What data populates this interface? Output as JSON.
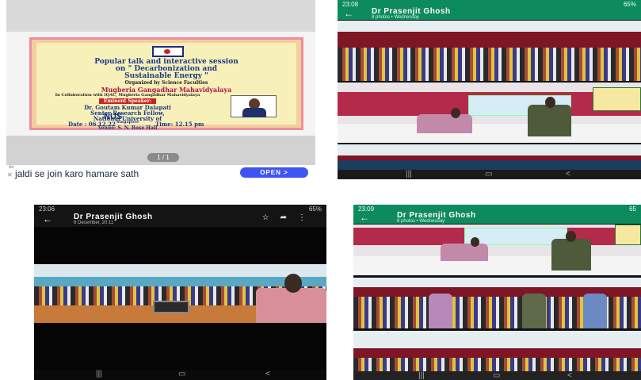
{
  "poster_viewer": {
    "poster": {
      "title_line1": "Popular talk and interactive session",
      "title_line2": "on \" Decarbonization and",
      "title_line3": "Sustainable Energy \"",
      "organized_by": "Organized by Science Faculties",
      "college": "Mugberia Gangadhar Mahavidyalaya",
      "collaboration": "In Collaboration with IQAC, Mugberia Gangadhar Mahavidyalaya",
      "eminent_speaker": "Eminent Speaker:",
      "speaker_name": "Dr. Goutam Kumar Dalapati",
      "speaker_role": "Senior Research Fellow,",
      "speaker_org": "National University of",
      "speaker_country": "Singapore",
      "nus": "NUS",
      "date": "Date : 06.12.22",
      "time": "Time: 12.15 pm",
      "venue": "Venue: S. N. Bose Hall"
    },
    "page_indicator": "1 / 1",
    "ad": {
      "label": "Ad",
      "text": "jaldi se join karo hamare sath",
      "button": "OPEN >"
    }
  },
  "gallery_top_right": {
    "status_time": "23:08",
    "status_battery": "65%",
    "contact": "Dr Prasenjit Ghosh",
    "subtitle": "8 photos • Wednesday"
  },
  "gallery_bottom_left": {
    "status_time": "23:06",
    "status_battery": "65%",
    "contact": "Dr Prasenjit Ghosh",
    "subtitle": "6 December, 20:11"
  },
  "gallery_bottom_right": {
    "status_time": "23:09",
    "status_battery": "65",
    "contact": "Dr Prasenjit Ghosh",
    "subtitle": "8 photos • Wednesday"
  },
  "colors": {
    "whatsapp_header": "#0d8a5e",
    "ad_button": "#3f55f2",
    "poster_border": "#f08c9c"
  },
  "icons": [
    "back-arrow-icon",
    "star-icon",
    "forward-icon",
    "more-vert-icon",
    "recents-icon",
    "home-icon",
    "back-nav-icon"
  ]
}
